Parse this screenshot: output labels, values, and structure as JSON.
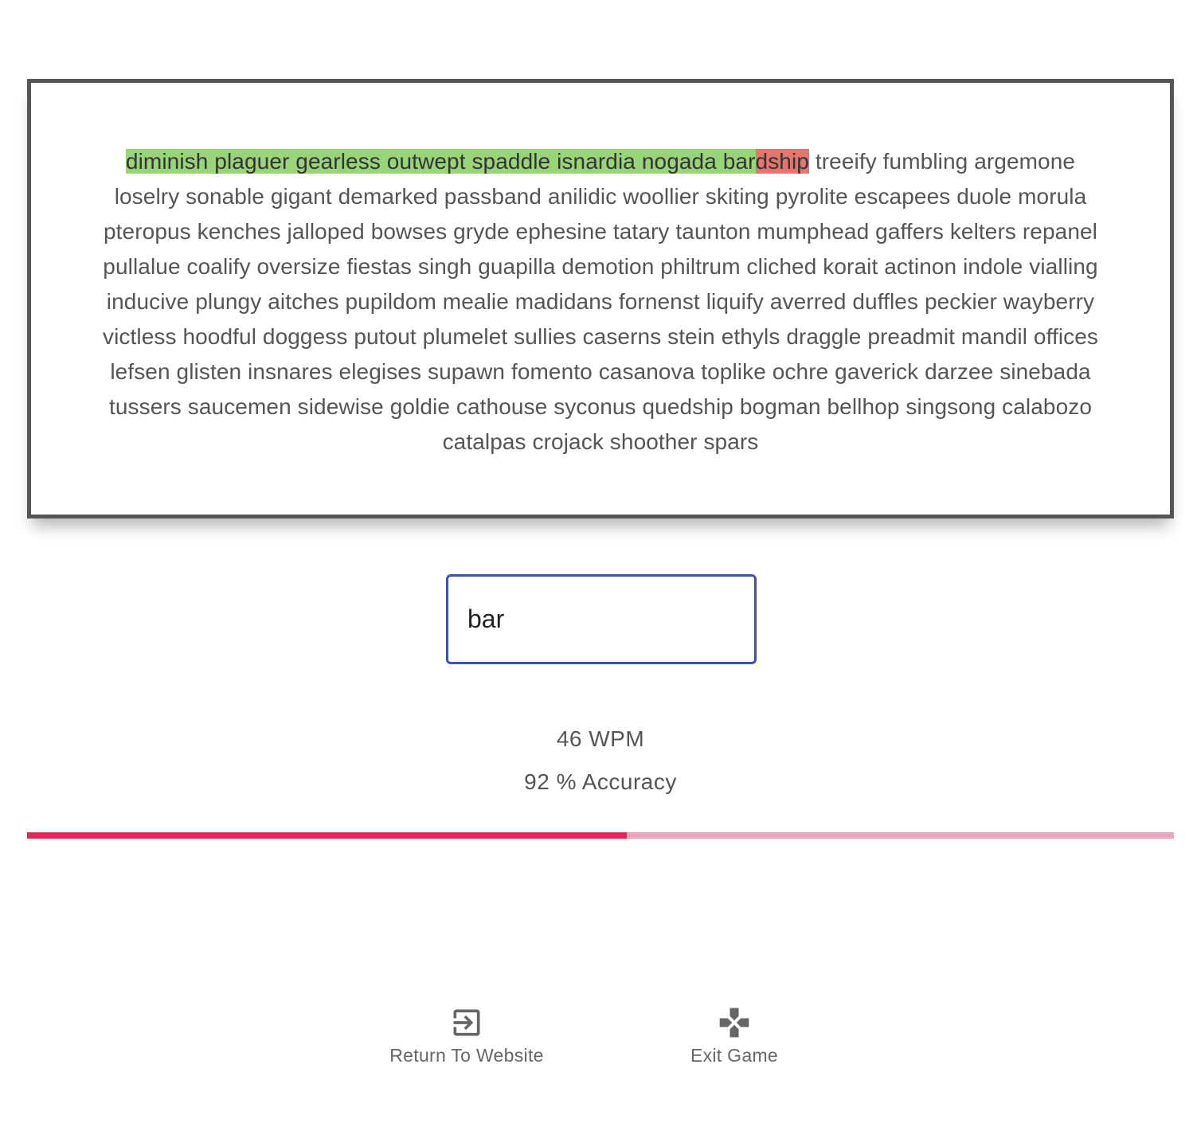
{
  "passage": {
    "correct_text": "diminish plaguer gearless outwept spaddle isnardia nogada bar",
    "error_text": "dship",
    "remaining_text": " treeify fumbling argemone loselry sonable gigant demarked passband anilidic woollier skiting pyrolite escapees duole morula pteropus kenches jalloped bowses gryde ephesine tatary taunton mumphead gaffers kelters repanel pullalue coalify oversize fiestas singh guapilla demotion philtrum cliched korait actinon indole vialling inducive plungy aitches pupildom mealie madidans fornenst liquify averred duffles peckier wayberry victless hoodful doggess putout plumelet sullies caserns stein ethyls draggle preadmit mandil offices lefsen glisten insnares elegises supawn fomento casanova toplike ochre gaverick darzee sinebada tussers saucemen sidewise goldie cathouse syconus quedship bogman bellhop singsong calabozo catalpas crojack shoother spars"
  },
  "input": {
    "value": "bar"
  },
  "stats": {
    "wpm": "46 WPM",
    "accuracy": "92 % Accuracy"
  },
  "progress": {
    "fraction": 0.523
  },
  "footer": {
    "return_label": "Return To Website",
    "return_icon": "exit-to-app-icon",
    "exit_label": "Exit Game",
    "exit_icon": "gamepad-icon"
  },
  "colors": {
    "correct_highlight": "#99d47a",
    "error_highlight": "#e5756f",
    "input_border": "#3f51b5",
    "progress_fill": "#dc2a55",
    "progress_track": "#eba4bd"
  }
}
